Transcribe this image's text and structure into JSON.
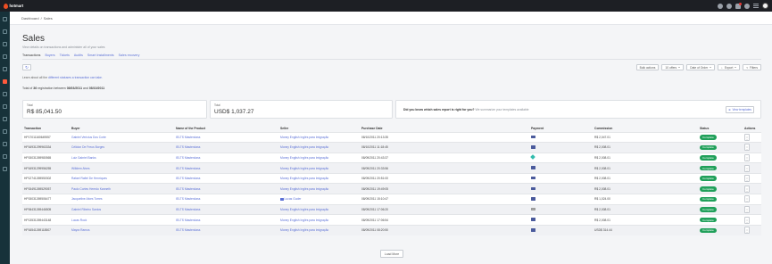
{
  "app": {
    "brand": "hotmart"
  },
  "breadcrumb": {
    "home": "Dashboard",
    "separator": "/",
    "current": "Sales"
  },
  "page": {
    "title": "Sales",
    "subtitle": "View details on transactions and administer all of your sales"
  },
  "tabs": [
    {
      "label": "Transactions",
      "active": true
    },
    {
      "label": "Buyers",
      "active": false
    },
    {
      "label": "Tickets",
      "active": false
    },
    {
      "label": "Audits",
      "active": false
    },
    {
      "label": "Smart Installments",
      "active": false
    },
    {
      "label": "Sales recovery",
      "active": false
    }
  ],
  "toolbar": {
    "refresh_icon": "refresh-icon",
    "bulk_actions": "Bulk actions",
    "per_page": "10 offers",
    "sort": "Date of Order",
    "export": "Export",
    "filters": "Filters"
  },
  "learn": {
    "prefix": "Learn about all the",
    "link": "different statuses a transaction can take."
  },
  "total_line": {
    "prefix": "Total of",
    "count": "36",
    "middle": "registration between",
    "start": "08/03/2011",
    "and": "and",
    "end": "08/10/2011"
  },
  "cards": {
    "brl": {
      "label": "Total",
      "value": "R$ 85,041.50"
    },
    "usd": {
      "label": "Total",
      "value": "USD$ 1,037.27"
    },
    "promo": {
      "question": "Did you know which sales report is right for you?",
      "hint": "We summarize your templates available",
      "button": "View templates"
    }
  },
  "table": {
    "headers": [
      "Transaction",
      "Buyer",
      "Name of the Product",
      "Seller",
      "Purchase Date",
      "Payment",
      "Commission",
      "Status",
      "Actions"
    ],
    "rows": [
      {
        "transaction": "HP17011160649557",
        "buyer": "Gabriel Vericius Dos Corte",
        "product": "IELTS Masterclass",
        "seller": "Money English Inglés para Imigração",
        "date": "08/10/2011 20:13:35",
        "payment": "card",
        "commission": "R$ 2,047.01",
        "status": "Complete"
      },
      {
        "transaction": "HP16931299963334",
        "buyer": "Célidon De Freus Borges",
        "product": "IELTS Masterclass",
        "seller": "Money English Inglés para Imigração",
        "date": "08/10/2011 11:18:45",
        "payment": "card",
        "commission": "R$ 2,008.01",
        "status": "Complete"
      },
      {
        "transaction": "HP15031269980565",
        "buyer": "Luiz Gabriel Banks",
        "product": "IELTS Masterclass",
        "seller": "Money English Inglés para Imigração",
        "date": "08/09/2011 20:43:37",
        "payment": "pix",
        "commission": "R$ 2,008.01",
        "status": "Complete"
      },
      {
        "transaction": "HP16931299956255",
        "buyer": "Willdem Alves",
        "product": "IELTS Masterclass",
        "seller": "Money English Inglés para Imigração",
        "date": "08/09/2011 20:33:56",
        "payment": "card",
        "commission": "R$ 2,008.01",
        "status": "Complete"
      },
      {
        "transaction": "HP12741269550302",
        "buyer": "Rafael Rafiel De Henriques",
        "product": "IELTS Masterclass",
        "seller": "Money English Inglés para Imigração",
        "date": "08/09/2011 20:51:00",
        "payment": "card",
        "commission": "R$ 2,008.01",
        "status": "Complete"
      },
      {
        "transaction": "HP15491269529057",
        "buyer": "Paulo Cortes Heredo Kanneth",
        "product": "IELTS Masterclass",
        "seller": "Money English Inglés para Imigração",
        "date": "08/09/2011 19:49:05",
        "payment": "card",
        "commission": "R$ 2,008.01",
        "status": "Complete"
      },
      {
        "transaction": "HP15031269506477",
        "buyer": "Jacqueline Alves Torres",
        "product": "IELTS Masterclass",
        "seller": "Lucas Guder",
        "date": "08/09/2011 15:10:47",
        "payment": "card",
        "commission": "R$ 1,024.00",
        "status": "Complete"
      },
      {
        "transaction": "HP06431269446505",
        "buyer": "Gabriel Ribeiro Santos",
        "product": "IELTS Masterclass",
        "seller": "Money English Inglés para Imigração",
        "date": "08/09/2011 17:06:20",
        "payment": "boleto",
        "commission": "R$ 2,008.01",
        "status": "Complete"
      },
      {
        "transaction": "HP13531269443148",
        "buyer": "Lucas Rock",
        "product": "IELTS Masterclass",
        "seller": "Money English Inglés para Imigração",
        "date": "08/09/2011 17:06:54",
        "payment": "card",
        "commission": "R$ 2,008.01",
        "status": "Complete"
      },
      {
        "transaction": "HP16541269118507",
        "buyer": "Mayra Ramos",
        "product": "IELTS Masterclass",
        "seller": "Money English Inglés para Imigração",
        "date": "08/09/2011 08:20:50",
        "payment": "card",
        "commission": "USD$ 314.44",
        "status": "Complete"
      }
    ]
  },
  "load_more": "Load More",
  "colors": {
    "accent": "#5b70d6",
    "status_complete": "#20a05a",
    "brand": "#ef4e23",
    "topbar": "#1d1f24",
    "sidebar": "#17323a"
  }
}
